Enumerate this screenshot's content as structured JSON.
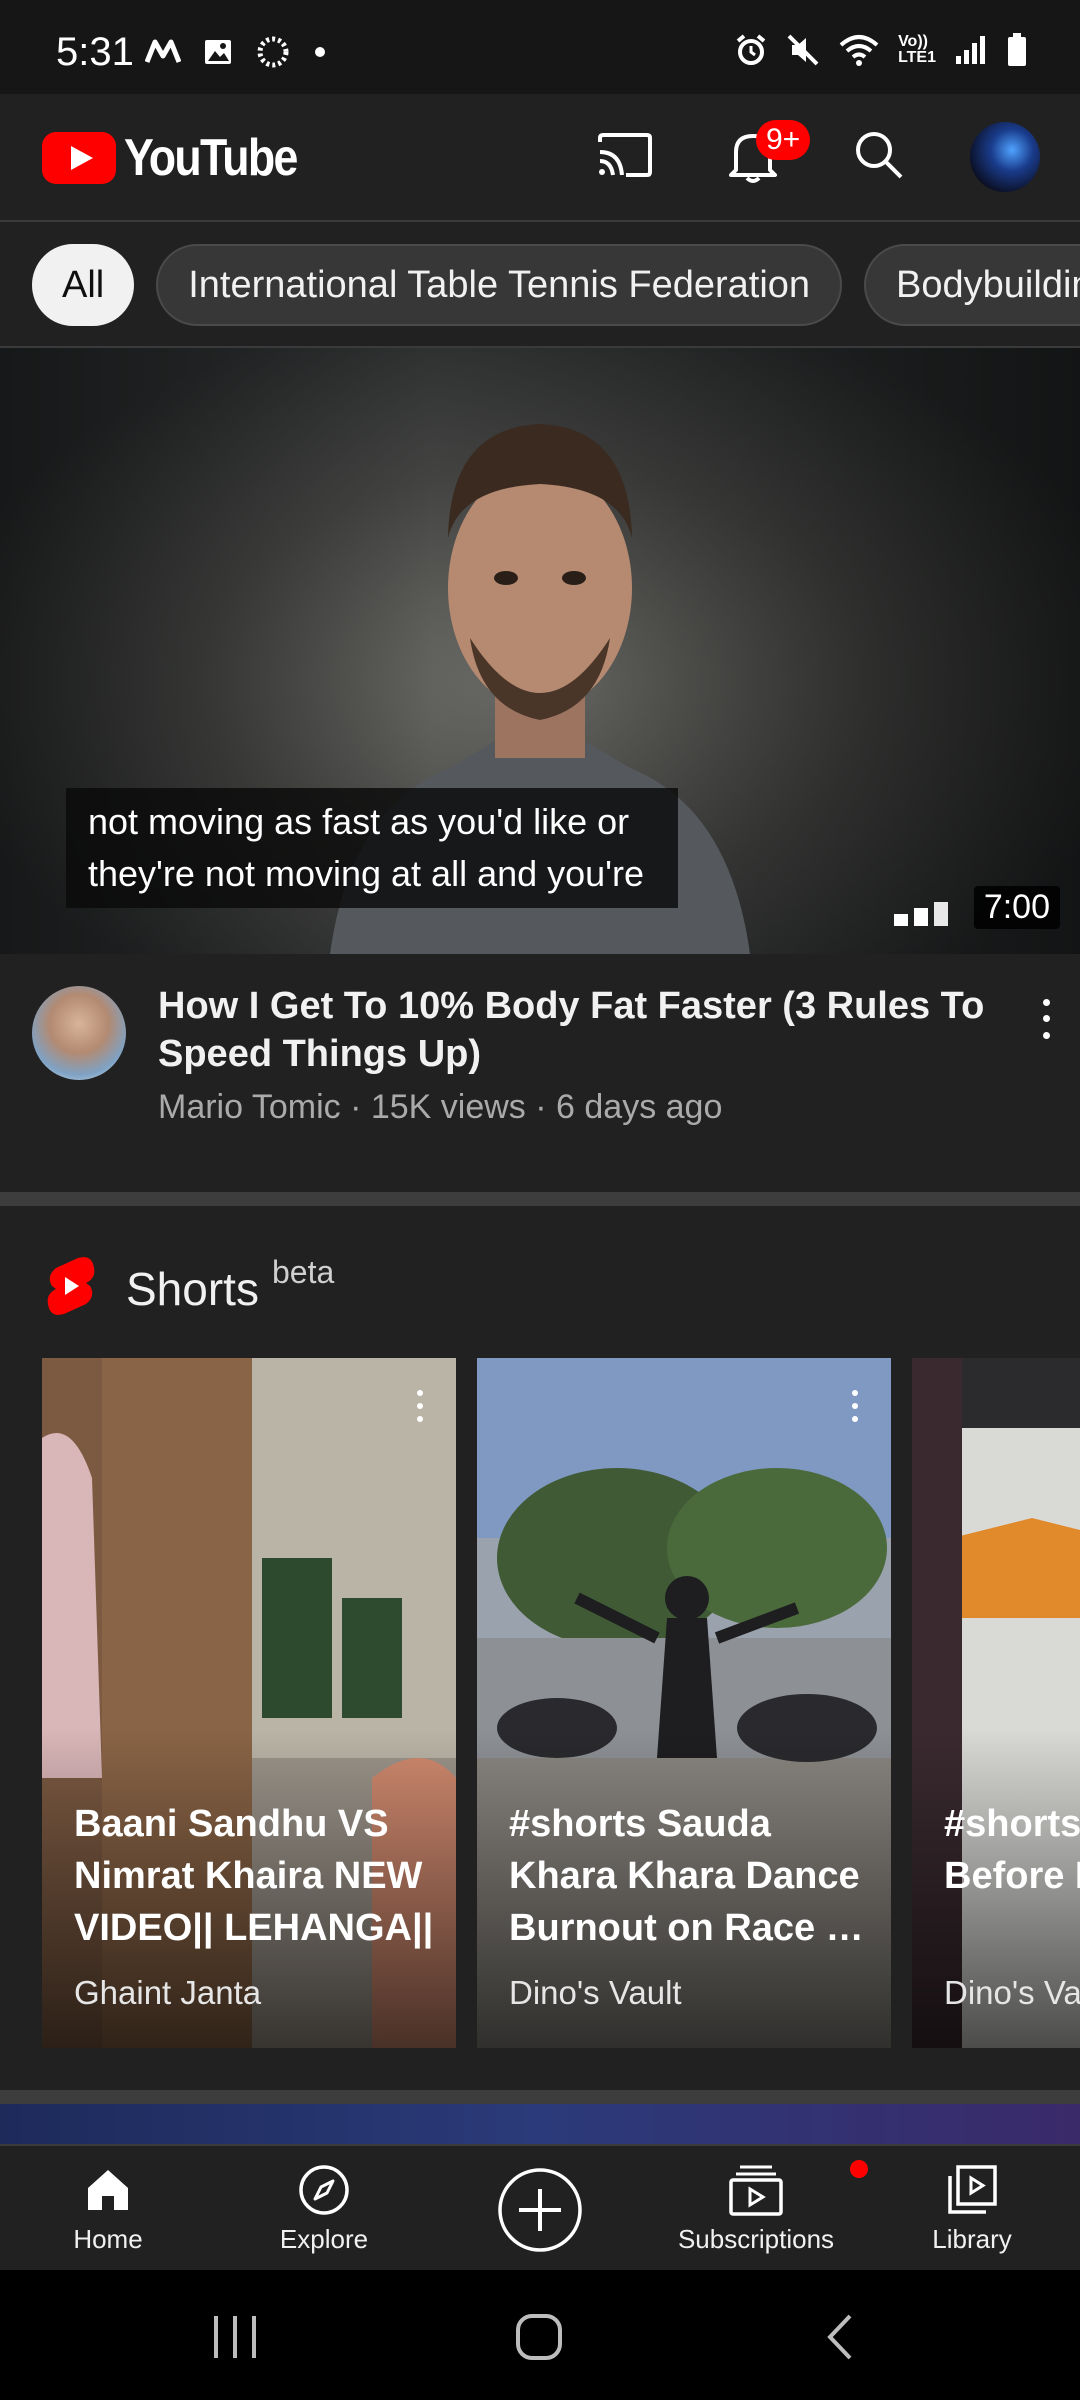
{
  "status_bar": {
    "time": "5:31",
    "volte_label_1": "Vo))",
    "volte_label_2": "LTE1"
  },
  "app_bar": {
    "logo_text": "YouTube",
    "notification_badge": "9+"
  },
  "chips": [
    {
      "label": "All",
      "active": true
    },
    {
      "label": "International Table Tennis Federation",
      "active": false
    },
    {
      "label": "Bodybuilding",
      "active": false
    }
  ],
  "video": {
    "caption_line1": "not moving as fast as you'd like or",
    "caption_line2": "they're not moving at all and you're",
    "duration": "7:00",
    "title": "How I Get To 10% Body Fat Faster (3 Rules To Speed Things Up)",
    "subtitle": "Mario Tomic · 15K views · 6 days ago"
  },
  "shorts": {
    "title": "Shorts",
    "badge": "beta",
    "items": [
      {
        "title": "Baani Sandhu VS Nimrat Khaira NEW VIDEO|| LEHANGA||",
        "channel": "Ghaint Janta"
      },
      {
        "title": "#shorts Sauda Khara Khara Dance Burnout on Race …",
        "channel": "Dino's Vault"
      },
      {
        "title": "#shorts Dheeme Before D",
        "channel": "Dino's Va"
      }
    ]
  },
  "bottom_nav": [
    {
      "label": "Home",
      "icon": "home-icon"
    },
    {
      "label": "Explore",
      "icon": "compass-icon"
    },
    {
      "label": "",
      "icon": "create-plus-icon"
    },
    {
      "label": "Subscriptions",
      "icon": "subscriptions-icon"
    },
    {
      "label": "Library",
      "icon": "library-icon"
    }
  ],
  "colors": {
    "background": "#212121",
    "brand_red": "#ff0000",
    "secondary_text": "#aaaaaa"
  }
}
